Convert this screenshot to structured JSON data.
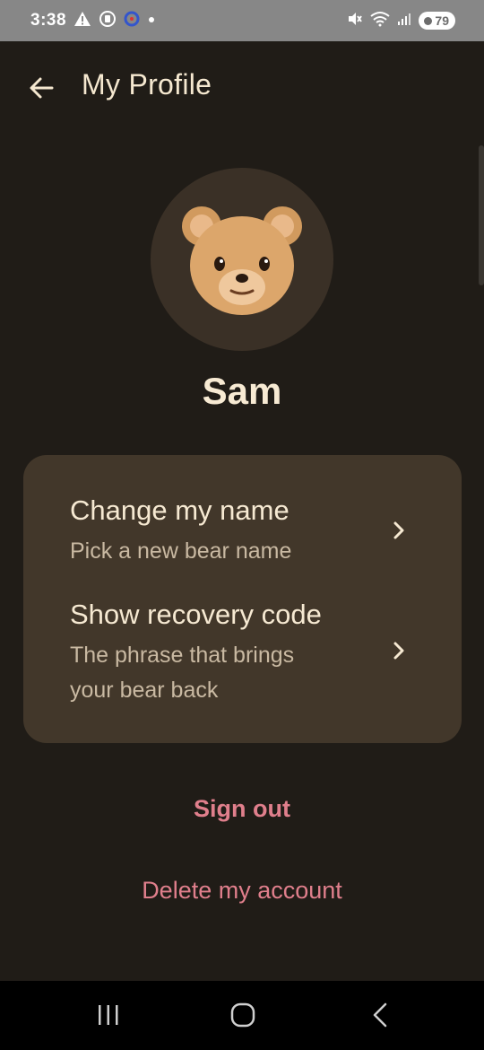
{
  "status_bar": {
    "time": "3:38",
    "battery": "79",
    "icons": [
      "warning-icon",
      "screen-record-icon",
      "app-notification-icon",
      "dot-icon",
      "mute-icon",
      "wifi-icon",
      "signal-icon",
      "battery-icon"
    ]
  },
  "header": {
    "title": "My Profile"
  },
  "profile": {
    "name": "Sam",
    "avatar": "bear-face-icon"
  },
  "settings": {
    "items": [
      {
        "title": "Change my name",
        "subtitle": "Pick a new bear name"
      },
      {
        "title": "Show recovery code",
        "subtitle_line1": "The phrase that brings",
        "subtitle_line2": "your bear back"
      }
    ]
  },
  "actions": {
    "sign_out": "Sign out",
    "delete_account": "Delete my account"
  },
  "colors": {
    "background": "#201c17",
    "card": "#42372a",
    "avatar_bg": "#3a3026",
    "accent": "#e07f8c",
    "text": "#f6e9d2"
  }
}
